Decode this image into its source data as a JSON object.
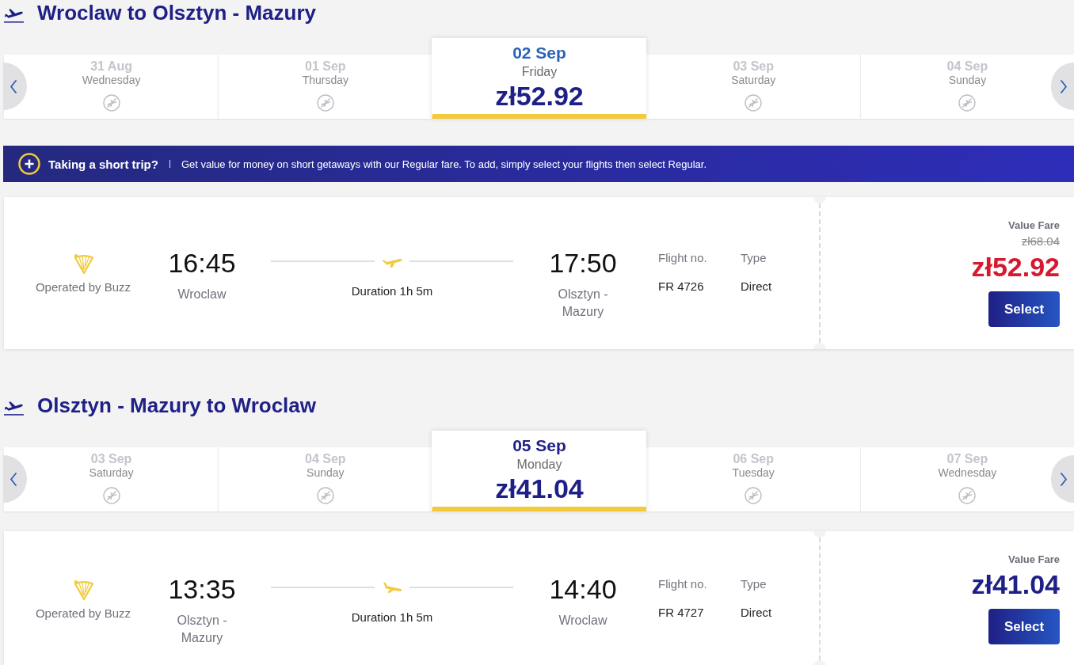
{
  "sections": [
    {
      "title": "Wroclaw to Olsztyn - Mazury",
      "dates": [
        {
          "date": "31 Aug",
          "weekday": "Wednesday",
          "selected": false,
          "hovered": false
        },
        {
          "date": "01 Sep",
          "weekday": "Thursday",
          "selected": false,
          "hovered": false
        },
        {
          "date": "02 Sep",
          "weekday": "Friday",
          "price": "zł52.92",
          "selected": true,
          "hovered": true
        },
        {
          "date": "03 Sep",
          "weekday": "Saturday",
          "selected": false,
          "hovered": false
        },
        {
          "date": "04 Sep",
          "weekday": "Sunday",
          "selected": false,
          "hovered": false
        }
      ],
      "banner": {
        "title": "Taking a short trip?",
        "text": "Get value for money on short getaways with our Regular fare. To add, simply select your flights then select Regular."
      },
      "flight": {
        "operator": "Operated by Buzz",
        "departure_time": "16:45",
        "departure_city": "Wroclaw",
        "duration": "Duration 1h 5m",
        "arrival_time": "17:50",
        "arrival_city": "Olsztyn - Mazury",
        "flight_no_label": "Flight no.",
        "flight_no": "FR 4726",
        "type_label": "Type",
        "type": "Direct",
        "fare_name": "Value Fare",
        "old_price": "zł68.04",
        "price": "zł52.92",
        "discounted": true,
        "button": "Select"
      }
    },
    {
      "title": "Olsztyn - Mazury to Wroclaw",
      "dates": [
        {
          "date": "03 Sep",
          "weekday": "Saturday",
          "selected": false,
          "hovered": false
        },
        {
          "date": "04 Sep",
          "weekday": "Sunday",
          "selected": false,
          "hovered": false
        },
        {
          "date": "05 Sep",
          "weekday": "Monday",
          "price": "zł41.04",
          "selected": true,
          "hovered": false
        },
        {
          "date": "06 Sep",
          "weekday": "Tuesday",
          "selected": false,
          "hovered": false
        },
        {
          "date": "07 Sep",
          "weekday": "Wednesday",
          "selected": false,
          "hovered": false
        }
      ],
      "flight": {
        "operator": "Operated by Buzz",
        "departure_time": "13:35",
        "departure_city": "Olsztyn - Mazury",
        "duration": "Duration 1h 5m",
        "arrival_time": "14:40",
        "arrival_city": "Wroclaw",
        "flight_no_label": "Flight no.",
        "flight_no": "FR 4727",
        "type_label": "Type",
        "type": "Direct",
        "fare_name": "Value Fare",
        "price": "zł41.04",
        "discounted": false,
        "button": "Select"
      }
    }
  ]
}
